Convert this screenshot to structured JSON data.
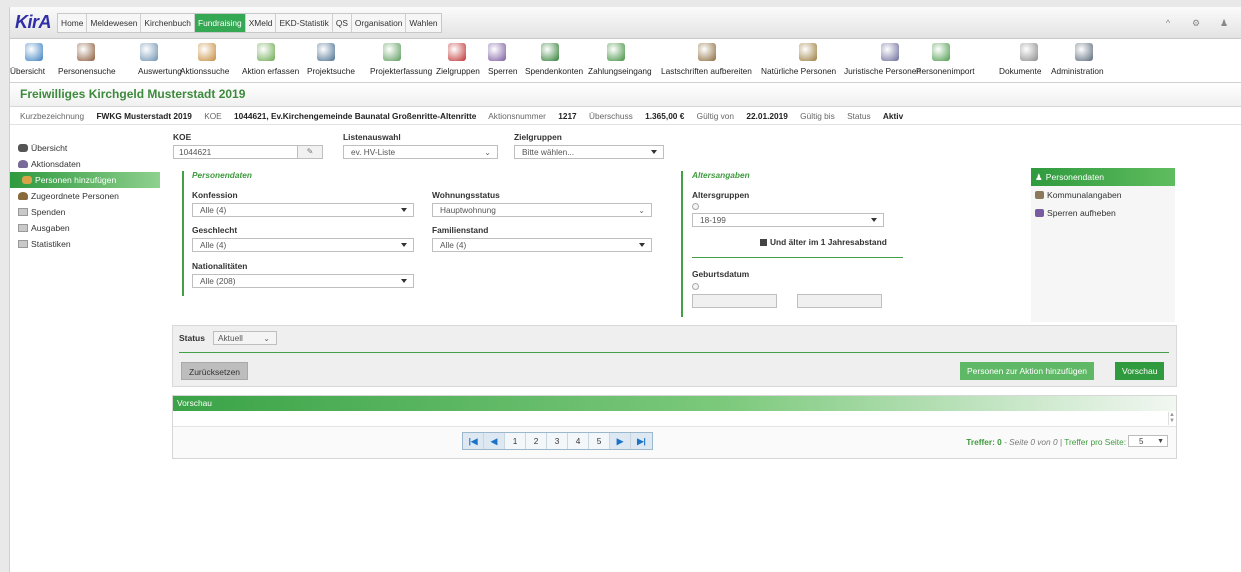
{
  "app": {
    "logo": "KirA"
  },
  "mainmenu": [
    "Home",
    "Meldewesen",
    "Kirchenbuch",
    "Fundraising",
    "XMeld",
    "EKD-Statistik",
    "QS",
    "Organisation",
    "Wahlen"
  ],
  "mainmenu_active": "Fundraising",
  "topright": [
    "^",
    "⚙",
    "♟"
  ],
  "toolbar": {
    "items": [
      {
        "label": "Übersicht",
        "icon": "signpost-icon",
        "color": "#3a7fc1"
      },
      {
        "label": "Personensuche",
        "icon": "person-search-icon",
        "color": "#8a5a3a"
      },
      {
        "label": "Auswertung",
        "icon": "chart-icon",
        "color": "#6a8fb0"
      },
      {
        "label": "Aktionssuche",
        "icon": "action-search-icon",
        "color": "#c48a3a"
      },
      {
        "label": "Aktion erfassen",
        "icon": "action-add-icon",
        "color": "#6aa84f"
      },
      {
        "label": "Projektsuche",
        "icon": "project-search-icon",
        "color": "#4a6f90"
      },
      {
        "label": "Projekterfassung",
        "icon": "project-add-icon",
        "color": "#5a9a5a"
      },
      {
        "label": "Zielgruppen",
        "icon": "target-icon",
        "color": "#c03030"
      },
      {
        "label": "Sperren",
        "icon": "block-icon",
        "color": "#7a5aa0"
      },
      {
        "label": "Spendenkonten",
        "icon": "account-icon",
        "color": "#2e7d32"
      },
      {
        "label": "Zahlungseingang",
        "icon": "payment-icon",
        "color": "#3f8f3f"
      },
      {
        "label": "Lastschriften aufbereiten",
        "icon": "debit-icon",
        "color": "#8a6a3a"
      },
      {
        "label": "Natürliche Personen",
        "icon": "persons-icon",
        "color": "#9a7a3a"
      },
      {
        "label": "Juristische Personen",
        "icon": "building-icon",
        "color": "#6a6a9a"
      },
      {
        "label": "Personenimport",
        "icon": "import-icon",
        "color": "#4a9a4a"
      },
      {
        "label": "Dokumente",
        "icon": "document-icon",
        "color": "#8a8a8a"
      },
      {
        "label": "Administration",
        "icon": "gears-icon",
        "color": "#5a6a7a"
      }
    ]
  },
  "page": {
    "title": "Freiwilliges Kirchgeld Musterstadt 2019",
    "info": {
      "kurz_label": "Kurzbezeichnung",
      "kurz_value": "FWKG Musterstadt 2019",
      "koe_label": "KOE",
      "koe_value": "1044621, Ev.Kirchengemeinde Baunatal Großenritte-Altenritte",
      "aktion_label": "Aktionsnummer",
      "aktion_value": "1217",
      "ueber_label": "Überschuss",
      "ueber_value": "1.365,00 €",
      "gv_label": "Gültig von",
      "gv_value": "22.01.2019",
      "gb_label": "Gültig bis",
      "status_label": "Status",
      "status_value": "Aktiv"
    }
  },
  "leftnav": [
    "Übersicht",
    "Aktionsdaten",
    "Personen hinzufügen",
    "Zugeordnete Personen",
    "Spenden",
    "Ausgaben",
    "Statistiken"
  ],
  "form": {
    "koe_label": "KOE",
    "koe_value": "1044621",
    "listen_label": "Listenauswahl",
    "listen_value": "ev. HV-Liste",
    "ziel_label": "Zielgruppen",
    "ziel_value": "Bitte wählen...",
    "personendaten_header": "Personendaten",
    "konfession_label": "Konfession",
    "konfession_value": "Alle (4)",
    "wohnung_label": "Wohnungsstatus",
    "wohnung_value": "Hauptwohnung",
    "geschlecht_label": "Geschlecht",
    "geschlecht_value": "Alle (4)",
    "familie_label": "Familienstand",
    "familie_value": "Alle (4)",
    "nation_label": "Nationalitäten",
    "nation_value": "Alle (208)",
    "alters_header": "Altersangaben",
    "altersgruppen_label": "Altersgruppen",
    "altersgruppen_value": "18-199",
    "checkbox_label": "Und älter im 1 Jahresabstand",
    "geburt_label": "Geburtsdatum"
  },
  "rightnav": [
    "Personendaten",
    "Kommunalangaben",
    "Sperren aufheben"
  ],
  "status": {
    "label": "Status",
    "value": "Aktuell",
    "reset": "Zurücksetzen",
    "add": "Personen zur Aktion hinzufügen",
    "preview": "Vorschau"
  },
  "vorschau": {
    "header": "Vorschau",
    "pages": [
      "1",
      "2",
      "3",
      "4",
      "5"
    ],
    "treffer_label": "Treffer: 0",
    "seite": "- Seite 0 von 0 |",
    "tps_label": "Treffer pro Seite:",
    "tps_value": "5"
  },
  "colors": {
    "accent": "#34a853",
    "title": "#3d8a3d",
    "logo": "#2e2ea8"
  }
}
